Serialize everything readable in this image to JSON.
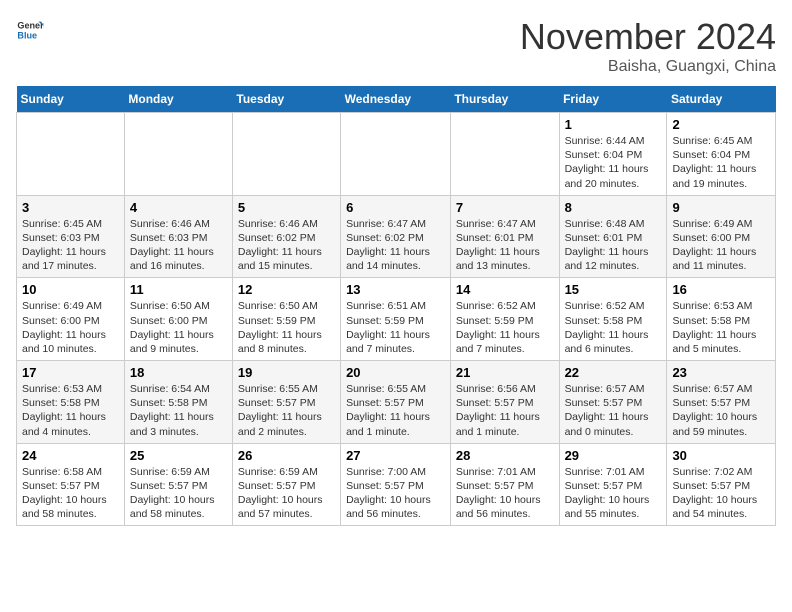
{
  "header": {
    "logo_line1": "General",
    "logo_line2": "Blue",
    "month": "November 2024",
    "location": "Baisha, Guangxi, China"
  },
  "weekdays": [
    "Sunday",
    "Monday",
    "Tuesday",
    "Wednesday",
    "Thursday",
    "Friday",
    "Saturday"
  ],
  "weeks": [
    [
      {
        "day": "",
        "info": ""
      },
      {
        "day": "",
        "info": ""
      },
      {
        "day": "",
        "info": ""
      },
      {
        "day": "",
        "info": ""
      },
      {
        "day": "",
        "info": ""
      },
      {
        "day": "1",
        "info": "Sunrise: 6:44 AM\nSunset: 6:04 PM\nDaylight: 11 hours and 20 minutes."
      },
      {
        "day": "2",
        "info": "Sunrise: 6:45 AM\nSunset: 6:04 PM\nDaylight: 11 hours and 19 minutes."
      }
    ],
    [
      {
        "day": "3",
        "info": "Sunrise: 6:45 AM\nSunset: 6:03 PM\nDaylight: 11 hours and 17 minutes."
      },
      {
        "day": "4",
        "info": "Sunrise: 6:46 AM\nSunset: 6:03 PM\nDaylight: 11 hours and 16 minutes."
      },
      {
        "day": "5",
        "info": "Sunrise: 6:46 AM\nSunset: 6:02 PM\nDaylight: 11 hours and 15 minutes."
      },
      {
        "day": "6",
        "info": "Sunrise: 6:47 AM\nSunset: 6:02 PM\nDaylight: 11 hours and 14 minutes."
      },
      {
        "day": "7",
        "info": "Sunrise: 6:47 AM\nSunset: 6:01 PM\nDaylight: 11 hours and 13 minutes."
      },
      {
        "day": "8",
        "info": "Sunrise: 6:48 AM\nSunset: 6:01 PM\nDaylight: 11 hours and 12 minutes."
      },
      {
        "day": "9",
        "info": "Sunrise: 6:49 AM\nSunset: 6:00 PM\nDaylight: 11 hours and 11 minutes."
      }
    ],
    [
      {
        "day": "10",
        "info": "Sunrise: 6:49 AM\nSunset: 6:00 PM\nDaylight: 11 hours and 10 minutes."
      },
      {
        "day": "11",
        "info": "Sunrise: 6:50 AM\nSunset: 6:00 PM\nDaylight: 11 hours and 9 minutes."
      },
      {
        "day": "12",
        "info": "Sunrise: 6:50 AM\nSunset: 5:59 PM\nDaylight: 11 hours and 8 minutes."
      },
      {
        "day": "13",
        "info": "Sunrise: 6:51 AM\nSunset: 5:59 PM\nDaylight: 11 hours and 7 minutes."
      },
      {
        "day": "14",
        "info": "Sunrise: 6:52 AM\nSunset: 5:59 PM\nDaylight: 11 hours and 7 minutes."
      },
      {
        "day": "15",
        "info": "Sunrise: 6:52 AM\nSunset: 5:58 PM\nDaylight: 11 hours and 6 minutes."
      },
      {
        "day": "16",
        "info": "Sunrise: 6:53 AM\nSunset: 5:58 PM\nDaylight: 11 hours and 5 minutes."
      }
    ],
    [
      {
        "day": "17",
        "info": "Sunrise: 6:53 AM\nSunset: 5:58 PM\nDaylight: 11 hours and 4 minutes."
      },
      {
        "day": "18",
        "info": "Sunrise: 6:54 AM\nSunset: 5:58 PM\nDaylight: 11 hours and 3 minutes."
      },
      {
        "day": "19",
        "info": "Sunrise: 6:55 AM\nSunset: 5:57 PM\nDaylight: 11 hours and 2 minutes."
      },
      {
        "day": "20",
        "info": "Sunrise: 6:55 AM\nSunset: 5:57 PM\nDaylight: 11 hours and 1 minute."
      },
      {
        "day": "21",
        "info": "Sunrise: 6:56 AM\nSunset: 5:57 PM\nDaylight: 11 hours and 1 minute."
      },
      {
        "day": "22",
        "info": "Sunrise: 6:57 AM\nSunset: 5:57 PM\nDaylight: 11 hours and 0 minutes."
      },
      {
        "day": "23",
        "info": "Sunrise: 6:57 AM\nSunset: 5:57 PM\nDaylight: 10 hours and 59 minutes."
      }
    ],
    [
      {
        "day": "24",
        "info": "Sunrise: 6:58 AM\nSunset: 5:57 PM\nDaylight: 10 hours and 58 minutes."
      },
      {
        "day": "25",
        "info": "Sunrise: 6:59 AM\nSunset: 5:57 PM\nDaylight: 10 hours and 58 minutes."
      },
      {
        "day": "26",
        "info": "Sunrise: 6:59 AM\nSunset: 5:57 PM\nDaylight: 10 hours and 57 minutes."
      },
      {
        "day": "27",
        "info": "Sunrise: 7:00 AM\nSunset: 5:57 PM\nDaylight: 10 hours and 56 minutes."
      },
      {
        "day": "28",
        "info": "Sunrise: 7:01 AM\nSunset: 5:57 PM\nDaylight: 10 hours and 56 minutes."
      },
      {
        "day": "29",
        "info": "Sunrise: 7:01 AM\nSunset: 5:57 PM\nDaylight: 10 hours and 55 minutes."
      },
      {
        "day": "30",
        "info": "Sunrise: 7:02 AM\nSunset: 5:57 PM\nDaylight: 10 hours and 54 minutes."
      }
    ]
  ]
}
